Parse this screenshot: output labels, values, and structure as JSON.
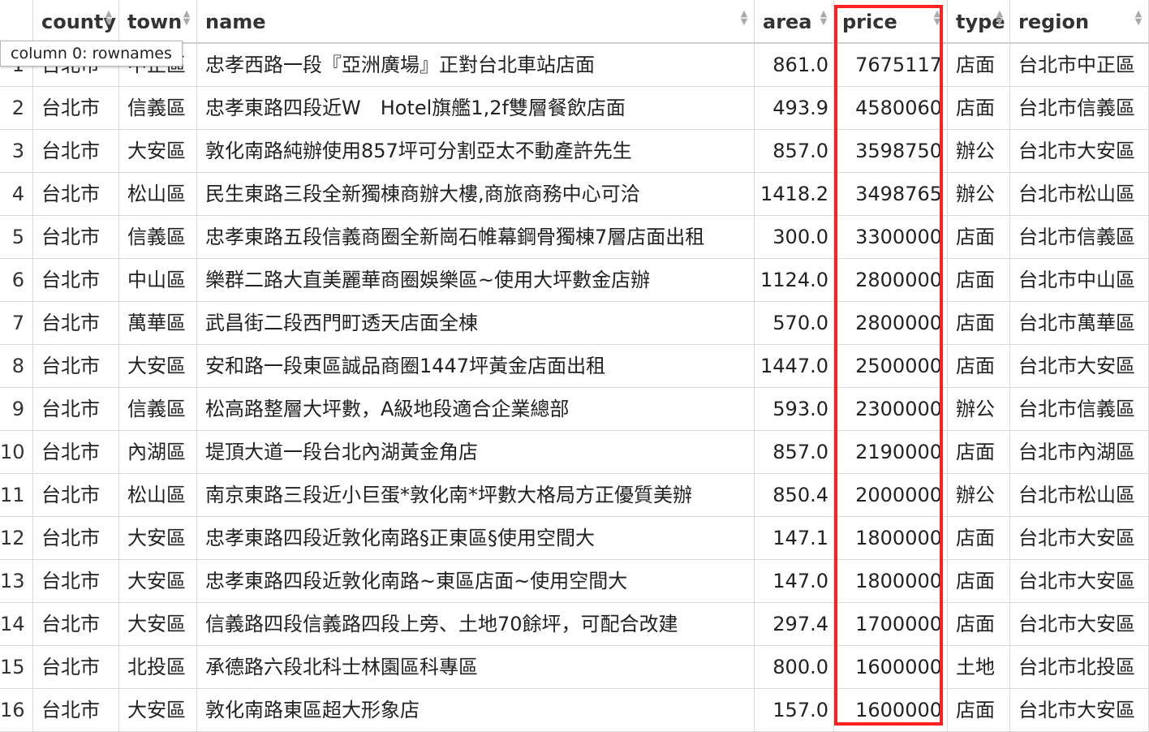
{
  "table": {
    "columns": [
      {
        "key": "rn",
        "label": ""
      },
      {
        "key": "county",
        "label": "county"
      },
      {
        "key": "town",
        "label": "town"
      },
      {
        "key": "name",
        "label": "name"
      },
      {
        "key": "area",
        "label": "area"
      },
      {
        "key": "price",
        "label": "price"
      },
      {
        "key": "type",
        "label": "type"
      },
      {
        "key": "region",
        "label": "region"
      }
    ],
    "rows": [
      {
        "rn": "1",
        "county": "台北市",
        "town": "中正區",
        "name": "忠孝西路一段『亞洲廣場』正對台北車站店面",
        "area": "861.0",
        "price": "7675117",
        "type": "店面",
        "region": "台北市中正區"
      },
      {
        "rn": "2",
        "county": "台北市",
        "town": "信義區",
        "name": "忠孝東路四段近W　Hotel旗艦1,2f雙層餐飲店面",
        "area": "493.9",
        "price": "4580060",
        "type": "店面",
        "region": "台北市信義區"
      },
      {
        "rn": "3",
        "county": "台北市",
        "town": "大安區",
        "name": "敦化南路純辦使用857坪可分割亞太不動產許先生",
        "area": "857.0",
        "price": "3598750",
        "type": "辦公",
        "region": "台北市大安區"
      },
      {
        "rn": "4",
        "county": "台北市",
        "town": "松山區",
        "name": "民生東路三段全新獨棟商辦大樓,商旅商務中心可洽",
        "area": "1418.2",
        "price": "3498765",
        "type": "辦公",
        "region": "台北市松山區"
      },
      {
        "rn": "5",
        "county": "台北市",
        "town": "信義區",
        "name": "忠孝東路五段信義商圈全新崗石帷幕鋼骨獨棟7層店面出租",
        "area": "300.0",
        "price": "3300000",
        "type": "店面",
        "region": "台北市信義區"
      },
      {
        "rn": "6",
        "county": "台北市",
        "town": "中山區",
        "name": "樂群二路大直美麗華商圈娛樂區~使用大坪數金店辦",
        "area": "1124.0",
        "price": "2800000",
        "type": "店面",
        "region": "台北市中山區"
      },
      {
        "rn": "7",
        "county": "台北市",
        "town": "萬華區",
        "name": "武昌街二段西門町透天店面全棟",
        "area": "570.0",
        "price": "2800000",
        "type": "店面",
        "region": "台北市萬華區"
      },
      {
        "rn": "8",
        "county": "台北市",
        "town": "大安區",
        "name": "安和路一段東區誠品商圈1447坪黃金店面出租",
        "area": "1447.0",
        "price": "2500000",
        "type": "店面",
        "region": "台北市大安區"
      },
      {
        "rn": "9",
        "county": "台北市",
        "town": "信義區",
        "name": "松高路整層大坪數，A級地段適合企業總部",
        "area": "593.0",
        "price": "2300000",
        "type": "辦公",
        "region": "台北市信義區"
      },
      {
        "rn": "10",
        "county": "台北市",
        "town": "內湖區",
        "name": "堤頂大道一段台北內湖黃金角店",
        "area": "857.0",
        "price": "2190000",
        "type": "店面",
        "region": "台北市內湖區"
      },
      {
        "rn": "11",
        "county": "台北市",
        "town": "松山區",
        "name": "南京東路三段近小巨蛋*敦化南*坪數大格局方正優質美辦",
        "area": "850.4",
        "price": "2000000",
        "type": "辦公",
        "region": "台北市松山區"
      },
      {
        "rn": "12",
        "county": "台北市",
        "town": "大安區",
        "name": "忠孝東路四段近敦化南路§正東區§使用空間大",
        "area": "147.1",
        "price": "1800000",
        "type": "店面",
        "region": "台北市大安區"
      },
      {
        "rn": "13",
        "county": "台北市",
        "town": "大安區",
        "name": "忠孝東路四段近敦化南路~東區店面~使用空間大",
        "area": "147.0",
        "price": "1800000",
        "type": "店面",
        "region": "台北市大安區"
      },
      {
        "rn": "14",
        "county": "台北市",
        "town": "大安區",
        "name": "信義路四段信義路四段上旁、土地70餘坪，可配合改建",
        "area": "297.4",
        "price": "1700000",
        "type": "店面",
        "region": "台北市大安區"
      },
      {
        "rn": "15",
        "county": "台北市",
        "town": "北投區",
        "name": "承德路六段北科士林園區科專區",
        "area": "800.0",
        "price": "1600000",
        "type": "土地",
        "region": "台北市北投區"
      },
      {
        "rn": "16",
        "county": "台北市",
        "town": "大安區",
        "name": "敦化南路東區超大形象店",
        "area": "157.0",
        "price": "1600000",
        "type": "店面",
        "region": "台北市大安區"
      }
    ]
  },
  "tooltip": {
    "text": "column 0: rownames"
  },
  "highlight": {
    "column": "price",
    "color": "#ff2121"
  }
}
